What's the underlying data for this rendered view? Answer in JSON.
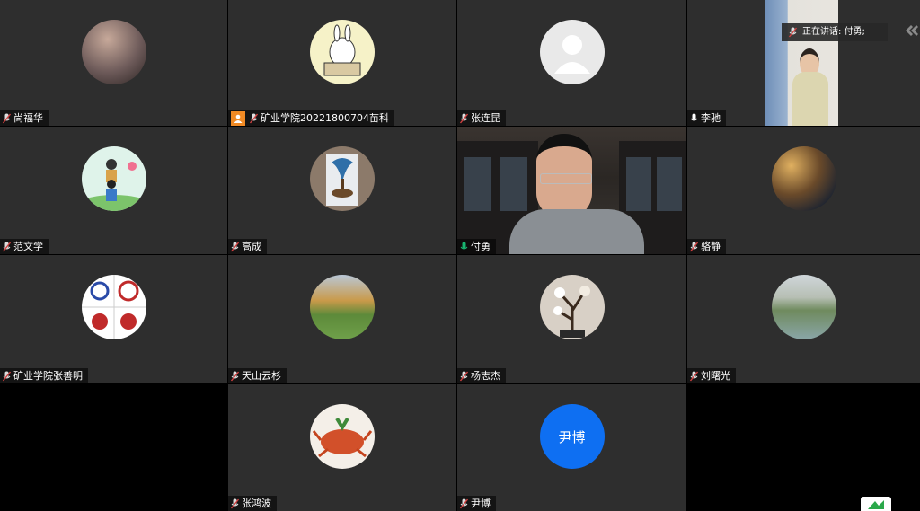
{
  "speaking_label": "正在讲话: 付勇;",
  "participants": [
    {
      "name": "尚福华",
      "mic": "muted"
    },
    {
      "name": "矿业学院20221800704苗科",
      "mic": "muted",
      "host": true
    },
    {
      "name": "张连昆",
      "mic": "muted"
    },
    {
      "name": "李驰",
      "mic": "on"
    },
    {
      "name": "范文学",
      "mic": "muted"
    },
    {
      "name": "高成",
      "mic": "muted"
    },
    {
      "name": "付勇",
      "mic": "speaking"
    },
    {
      "name": "骆静",
      "mic": "muted"
    },
    {
      "name": "矿业学院张善明",
      "mic": "muted"
    },
    {
      "name": "天山云杉",
      "mic": "muted"
    },
    {
      "name": "杨志杰",
      "mic": "muted"
    },
    {
      "name": "刘曙光",
      "mic": "muted"
    },
    {
      "name": "张鸿波",
      "mic": "muted"
    },
    {
      "name": "尹博",
      "mic": "muted",
      "avatar_text": "尹博"
    }
  ],
  "colors": {
    "accent": "#18b470",
    "muted_mic": "#d04040",
    "avatar_blue": "#0e6ff2",
    "host_badge": "#f08a24"
  }
}
